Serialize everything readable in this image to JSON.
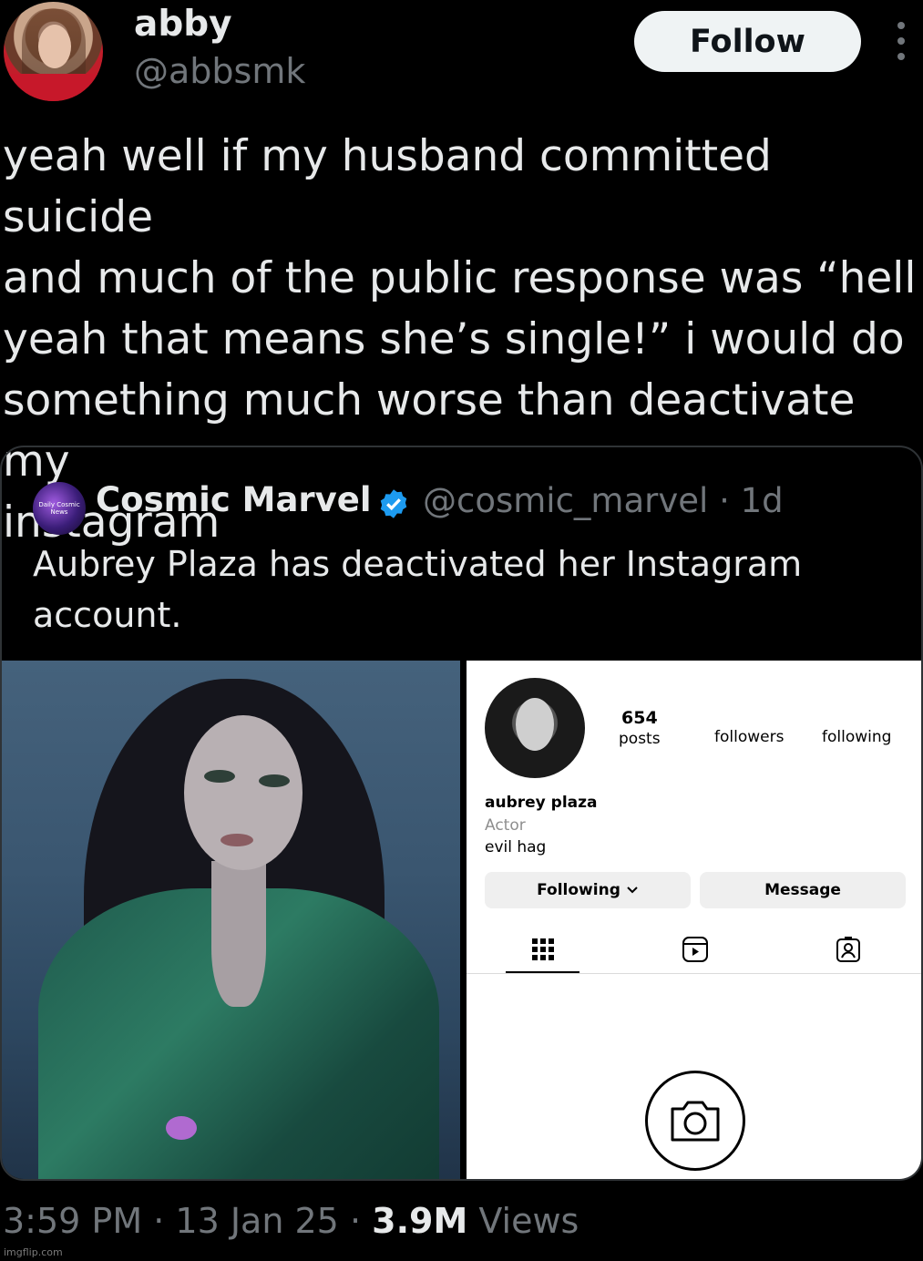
{
  "tweet": {
    "author_name": "abby",
    "author_handle": "@abbsmk",
    "follow_label": "Follow",
    "text": "yeah well if my husband committed suicide\nand much of the public response was “hell\nyeah that means she’s single!” i would do\nsomething much worse than deactivate my\ninstagram",
    "time": "3:59 PM",
    "date": "13 Jan 25",
    "views_count": "3.9M",
    "views_label": "Views",
    "separator": "·"
  },
  "quote": {
    "author_name": "Cosmic Marvel",
    "author_handle": "@cosmic_marvel",
    "age": "1d",
    "text": "Aubrey Plaza has deactivated her Instagram account.",
    "avatar_text": "Daily Cosmic News"
  },
  "instagram": {
    "posts_count": "654",
    "posts_label": "posts",
    "followers_label": "followers",
    "following_label": "following",
    "name": "aubrey plaza",
    "category": "Actor",
    "bio": "evil hag",
    "following_button": "Following",
    "message_button": "Message"
  },
  "watermark": "imgflip.com",
  "colors": {
    "background": "#000000",
    "text": "#e7e9ea",
    "secondary": "#71767b",
    "verified": "#1d9bf0"
  }
}
